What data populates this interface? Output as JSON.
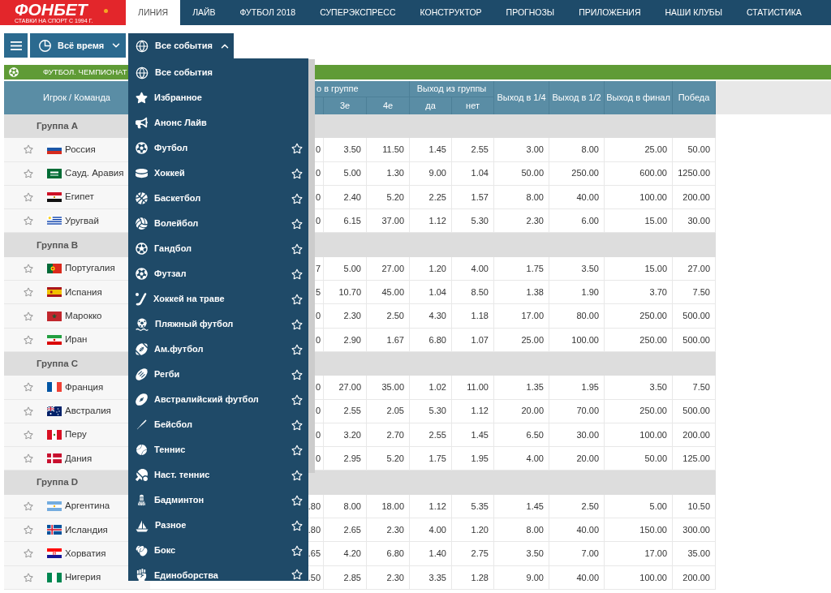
{
  "logo": {
    "name": "ФОНБЕТ",
    "tagline": "СТАВКИ НА СПОРТ С 1994 Г."
  },
  "nav_tabs": [
    {
      "label": "ЛИНИЯ",
      "selected": true
    },
    {
      "label": "ЛАЙВ",
      "selected": false
    },
    {
      "label": "ФУТБОЛ 2018",
      "selected": false
    },
    {
      "label": "СУПЕРЭКСПРЕСС",
      "selected": false
    },
    {
      "label": "КОНСТРУКТОР",
      "selected": false
    },
    {
      "label": "ПРОГНОЗЫ",
      "selected": false
    },
    {
      "label": "ПРИЛОЖЕНИЯ",
      "selected": false
    },
    {
      "label": "НАШИ КЛУБЫ",
      "selected": false
    },
    {
      "label": "СТАТИСТИКА",
      "selected": false
    }
  ],
  "toolbar": {
    "period_button": {
      "label": "Всё время",
      "expanded": false
    },
    "events_button": {
      "label": "Все события",
      "expanded": true
    }
  },
  "events_menu": [
    {
      "label": "Все события",
      "kind": "filter"
    },
    {
      "label": "Избранное",
      "kind": "filter"
    },
    {
      "label": "Анонс Лайв",
      "kind": "filter"
    },
    {
      "label": "Футбол",
      "kind": "sport",
      "favorite": false
    },
    {
      "label": "Хоккей",
      "kind": "sport",
      "favorite": false
    },
    {
      "label": "Баскетбол",
      "kind": "sport",
      "favorite": false
    },
    {
      "label": "Волейбол",
      "kind": "sport",
      "favorite": false
    },
    {
      "label": "Гандбол",
      "kind": "sport",
      "favorite": false
    },
    {
      "label": "Футзал",
      "kind": "sport",
      "favorite": false
    },
    {
      "label": "Хоккей на траве",
      "kind": "sport",
      "favorite": false
    },
    {
      "label": "Пляжный футбол",
      "kind": "sport",
      "favorite": false
    },
    {
      "label": "Ам.футбол",
      "kind": "sport",
      "favorite": false
    },
    {
      "label": "Регби",
      "kind": "sport",
      "favorite": false
    },
    {
      "label": "Австралийский футбол",
      "kind": "sport",
      "favorite": false
    },
    {
      "label": "Бейсбол",
      "kind": "sport",
      "favorite": false
    },
    {
      "label": "Теннис",
      "kind": "sport",
      "favorite": false
    },
    {
      "label": "Наст. теннис",
      "kind": "sport",
      "favorite": false
    },
    {
      "label": "Бадминтон",
      "kind": "sport",
      "favorite": false
    },
    {
      "label": "Разное",
      "kind": "sport",
      "favorite": false
    },
    {
      "label": "Бокс",
      "kind": "sport",
      "favorite": false
    },
    {
      "label": "Единоборства",
      "kind": "sport",
      "favorite": false
    }
  ],
  "section_bar": {
    "title": "ФУТБОЛ. ЧЕМПИОНАТ"
  },
  "table": {
    "columns": {
      "player": "Игрок / Команда",
      "place_in_group": {
        "label": "о в группе",
        "sub": [
          "3е",
          "4е"
        ]
      },
      "exit_group": {
        "label": "Выход из группы",
        "sub": [
          "да",
          "нет"
        ]
      },
      "stages": [
        "Выход в 1/4",
        "Выход в 1/2",
        "Выход в финал",
        "Победа"
      ]
    },
    "groups": [
      {
        "name": "Группа A",
        "teams": [
          {
            "name": "Россия",
            "favorite": false,
            "column_cut": "0",
            "odds": [
              "3.50",
              "11.50",
              "1.45",
              "2.55",
              "3.00",
              "8.00",
              "25.00",
              "50.00"
            ]
          },
          {
            "name": "Сауд. Аравия",
            "favorite": false,
            "column_cut": "0",
            "odds": [
              "5.00",
              "1.30",
              "9.00",
              "1.04",
              "50.00",
              "250.00",
              "600.00",
              "1250.00"
            ]
          },
          {
            "name": "Египет",
            "favorite": false,
            "column_cut": "0",
            "odds": [
              "2.40",
              "5.20",
              "2.25",
              "1.57",
              "8.00",
              "40.00",
              "100.00",
              "200.00"
            ]
          },
          {
            "name": "Уругвай",
            "favorite": false,
            "column_cut": "0",
            "odds": [
              "6.15",
              "37.00",
              "1.12",
              "5.30",
              "2.30",
              "6.00",
              "15.00",
              "30.00"
            ]
          }
        ]
      },
      {
        "name": "Группа B",
        "teams": [
          {
            "name": "Португалия",
            "favorite": false,
            "column_cut": "7",
            "odds": [
              "5.00",
              "27.00",
              "1.20",
              "4.00",
              "1.75",
              "3.50",
              "15.00",
              "27.00"
            ]
          },
          {
            "name": "Испания",
            "favorite": false,
            "column_cut": "5",
            "odds": [
              "10.70",
              "45.00",
              "1.04",
              "8.50",
              "1.38",
              "1.90",
              "3.70",
              "7.50"
            ]
          },
          {
            "name": "Марокко",
            "favorite": false,
            "column_cut": "0",
            "odds": [
              "2.30",
              "2.50",
              "4.30",
              "1.18",
              "17.00",
              "80.00",
              "250.00",
              "500.00"
            ]
          },
          {
            "name": "Иран",
            "favorite": false,
            "column_cut": "0",
            "odds": [
              "2.90",
              "1.67",
              "6.80",
              "1.07",
              "25.00",
              "100.00",
              "250.00",
              "500.00"
            ]
          }
        ]
      },
      {
        "name": "Группа C",
        "teams": [
          {
            "name": "Франция",
            "favorite": false,
            "column_cut": "0",
            "odds": [
              "27.00",
              "35.00",
              "1.02",
              "11.00",
              "1.35",
              "1.95",
              "3.50",
              "7.50"
            ]
          },
          {
            "name": "Австралия",
            "favorite": false,
            "column_cut": "0",
            "odds": [
              "2.55",
              "2.05",
              "5.30",
              "1.12",
              "20.00",
              "70.00",
              "250.00",
              "500.00"
            ]
          },
          {
            "name": "Перу",
            "favorite": false,
            "column_cut": "0",
            "odds": [
              "3.20",
              "2.70",
              "2.55",
              "1.45",
              "6.50",
              "30.00",
              "100.00",
              "200.00"
            ]
          },
          {
            "name": "Дания",
            "favorite": false,
            "column_cut": "0",
            "odds": [
              "2.95",
              "5.20",
              "1.75",
              "1.95",
              "4.00",
              "20.00",
              "50.00",
              "125.00"
            ]
          }
        ]
      },
      {
        "name": "Группа D",
        "teams": [
          {
            "name": "Аргентина",
            "favorite": false,
            "column_cut": ".80",
            "odds": [
              "8.00",
              "18.00",
              "1.12",
              "5.35",
              "1.45",
              "2.50",
              "5.00",
              "10.50"
            ]
          },
          {
            "name": "Исландия",
            "favorite": false,
            "column_cut": ".80",
            "odds": [
              "2.65",
              "2.30",
              "4.00",
              "1.20",
              "8.00",
              "40.00",
              "150.00",
              "300.00"
            ]
          },
          {
            "name": "Хорватия",
            "favorite": false,
            "column_cut": ".65",
            "odds": [
              "4.20",
              "6.80",
              "1.40",
              "2.75",
              "3.50",
              "7.00",
              "17.00",
              "35.00"
            ]
          },
          {
            "name": "Нигерия",
            "favorite": false,
            "column_cut": ".50",
            "odds": [
              "2.85",
              "2.30",
              "3.35",
              "1.28",
              "9.00",
              "40.00",
              "100.00",
              "200.00"
            ]
          }
        ]
      }
    ]
  }
}
